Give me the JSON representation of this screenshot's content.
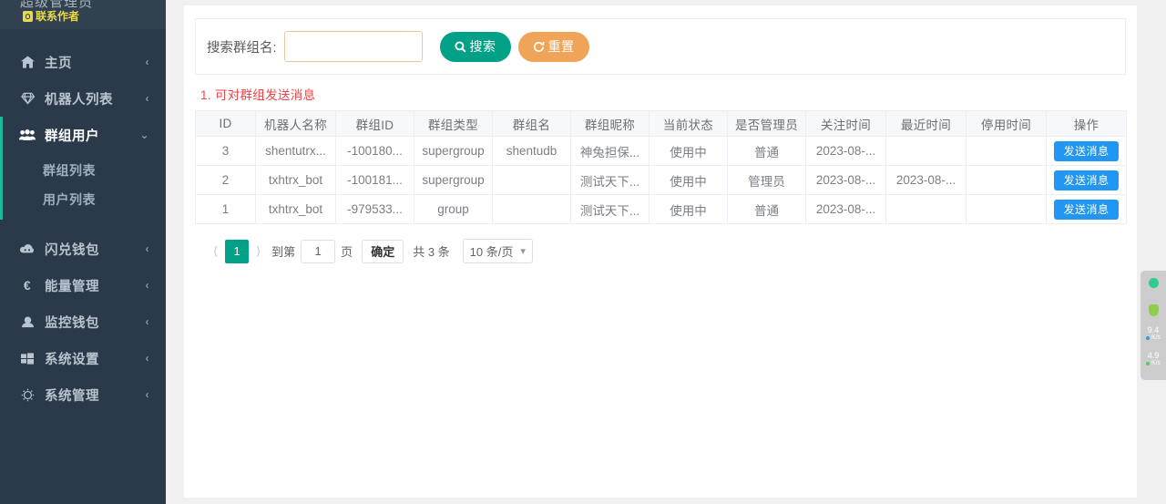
{
  "sidebar": {
    "user": {
      "name": "超级管理员",
      "contact_label": "联系作者",
      "contact_icon": "user-badge-icon"
    },
    "items": [
      {
        "label": "主页",
        "icon": "home-icon",
        "arrow": "‹",
        "active": false
      },
      {
        "label": "机器人列表",
        "icon": "gem-icon",
        "arrow": "‹",
        "active": false
      },
      {
        "label": "群组用户",
        "icon": "users-icon",
        "arrow": "⌄",
        "active": true,
        "children": [
          {
            "label": "群组列表"
          },
          {
            "label": "用户列表"
          }
        ]
      },
      {
        "label": "闪兑钱包",
        "icon": "cloud-icon",
        "arrow": "‹",
        "active": false
      },
      {
        "label": "能量管理",
        "icon": "euro-icon",
        "arrow": "‹",
        "active": false
      },
      {
        "label": "监控钱包",
        "icon": "wallet-icon",
        "arrow": "‹",
        "active": false
      },
      {
        "label": "系统设置",
        "icon": "windows-icon",
        "arrow": "‹",
        "active": false
      },
      {
        "label": "系统管理",
        "icon": "gear-icon",
        "arrow": "‹",
        "active": false
      }
    ]
  },
  "search": {
    "label": "搜索群组名:",
    "value": "",
    "placeholder": "",
    "search_button": "搜索",
    "search_icon": "search-icon",
    "reset_button": "重置",
    "reset_icon": "refresh-icon"
  },
  "notice": "1. 可对群组发送消息",
  "table": {
    "columns": [
      "ID",
      "机器人名称",
      "群组ID",
      "群组类型",
      "群组名",
      "群组昵称",
      "当前状态",
      "是否管理员",
      "关注时间",
      "最近时间",
      "停用时间",
      "操作"
    ],
    "rows": [
      {
        "id": "3",
        "bot_name": "shentutrx...",
        "group_id": "-100180...",
        "group_type": "supergroup",
        "group_name": "shentudb",
        "group_nickname": "神兔担保...",
        "status": "使用中",
        "is_admin": "普通",
        "follow_time": "2023-08-...",
        "recent_time": "",
        "stop_time": "",
        "action": "发送消息"
      },
      {
        "id": "2",
        "bot_name": "txhtrx_bot",
        "group_id": "-100181...",
        "group_type": "supergroup",
        "group_name": "",
        "group_nickname": "测试天下...",
        "status": "使用中",
        "is_admin": "管理员",
        "follow_time": "2023-08-...",
        "recent_time": "2023-08-...",
        "stop_time": "",
        "action": "发送消息"
      },
      {
        "id": "1",
        "bot_name": "txhtrx_bot",
        "group_id": "-979533...",
        "group_type": "group",
        "group_name": "",
        "group_nickname": "测试天下...",
        "status": "使用中",
        "is_admin": "普通",
        "follow_time": "2023-08-...",
        "recent_time": "",
        "stop_time": "",
        "action": "发送消息"
      }
    ]
  },
  "pagination": {
    "prev_icon": "chevron-left-icon",
    "next_icon": "chevron-right-icon",
    "current_page": "1",
    "goto_label": "到第",
    "goto_value": "1",
    "page_unit": "页",
    "confirm_label": "确定",
    "total_label": "共 3 条",
    "page_size": "10 条/页",
    "caret_icon": "chevron-down-icon"
  },
  "netwidget": {
    "down_value": "9.4",
    "down_unit": "K/s",
    "up_value": "4.9",
    "up_unit": "K/s"
  },
  "colors": {
    "sidebar_bg": "#2b3a4a",
    "accent_green": "#00a186",
    "accent_orange": "#efa457",
    "accent_blue": "#2196f3",
    "notice_red": "#f24444",
    "active_bar": "#1cb998"
  }
}
